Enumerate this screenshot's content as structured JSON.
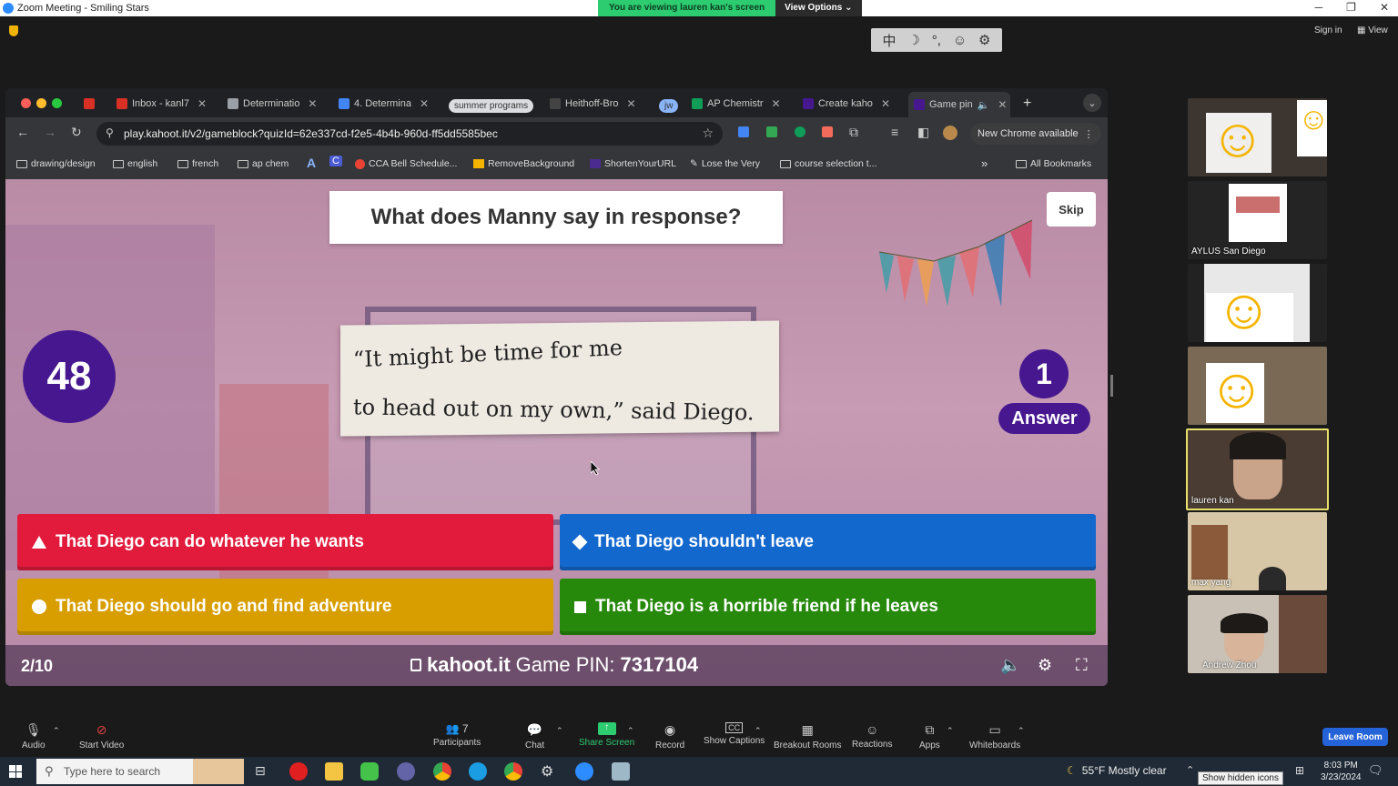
{
  "zoom": {
    "window_title": "Zoom Meeting - Smiling Stars",
    "viewing_banner": "You are viewing lauren kan's screen",
    "view_options": "View Options",
    "sign_in": "Sign in",
    "view": "View",
    "annotate_tools": [
      "中",
      "☽",
      "°,",
      "☺",
      "⚙"
    ]
  },
  "browser": {
    "tabs": [
      {
        "label": "",
        "icon": "gmail-icon"
      },
      {
        "label": "Inbox - kanl7",
        "icon": "gmail-icon"
      },
      {
        "label": "Determinatio",
        "icon": "contacts-icon"
      },
      {
        "label": "4. Determina",
        "icon": "docs-icon"
      },
      {
        "label": "summer programs",
        "icon": "tab-group-pill"
      },
      {
        "label": "Heithoff-Bro",
        "icon": "salk-icon"
      },
      {
        "label": "jw",
        "icon": "tab-group-pill"
      },
      {
        "label": "AP Chemistr",
        "icon": "sheets-icon"
      },
      {
        "label": "Create kaho",
        "icon": "kahoot-icon"
      },
      {
        "label": "Game pin",
        "icon": "kahoot-icon"
      }
    ],
    "url": "play.kahoot.it/v2/gameblock?quizId=62e337cd-f2e5-4b4b-960d-ff5dd5585bec",
    "new_chrome": "New Chrome available",
    "bookmarks": [
      "drawing/design",
      "english",
      "french",
      "ap chem",
      "A",
      "C",
      "CCA Bell Schedule...",
      "RemoveBackground",
      "ShortenYourURL",
      "Lose the Very",
      "course selection t...",
      "»",
      "All Bookmarks"
    ]
  },
  "kahoot": {
    "question": "What does Manny say in response?",
    "skip": "Skip",
    "quote_line1": "“It might be time for me",
    "quote_line2": "to head out on my own,” said Diego.",
    "timer": "48",
    "answer_count": "1",
    "answer_label": "Answer",
    "answers": [
      {
        "text": "That Diego can do whatever he wants",
        "color": "#e21b3c",
        "shape": "triangle"
      },
      {
        "text": "That Diego shouldn't leave",
        "color": "#1368ce",
        "shape": "diamond"
      },
      {
        "text": "That Diego should go and find adventure",
        "color": "#d89e00",
        "shape": "circle"
      },
      {
        "text": "That Diego is a horrible friend if he leaves",
        "color": "#26890c",
        "shape": "square"
      }
    ],
    "question_progress": "2/10",
    "site": "kahoot.it",
    "pin_label": "Game PIN:",
    "pin": "7317104"
  },
  "participants": [
    {
      "name": ""
    },
    {
      "name": "AYLUS San Diego"
    },
    {
      "name": ""
    },
    {
      "name": ""
    },
    {
      "name": "lauren kan"
    },
    {
      "name": "max yang"
    },
    {
      "name": "Andrew Zhou"
    }
  ],
  "toolbar": {
    "audio": "Audio",
    "start_video": "Start Video",
    "participants": "Participants",
    "participants_count": "7",
    "chat": "Chat",
    "share_screen": "Share Screen",
    "record": "Record",
    "show_captions": "Show Captions",
    "breakout_rooms": "Breakout Rooms",
    "reactions": "Reactions",
    "apps": "Apps",
    "whiteboards": "Whiteboards",
    "leave_room": "Leave Room"
  },
  "taskbar": {
    "search_placeholder": "Type here to search",
    "weather": "55°F  Mostly clear",
    "time": "8:03 PM",
    "date": "3/23/2024",
    "tooltip": "Show hidden icons"
  }
}
